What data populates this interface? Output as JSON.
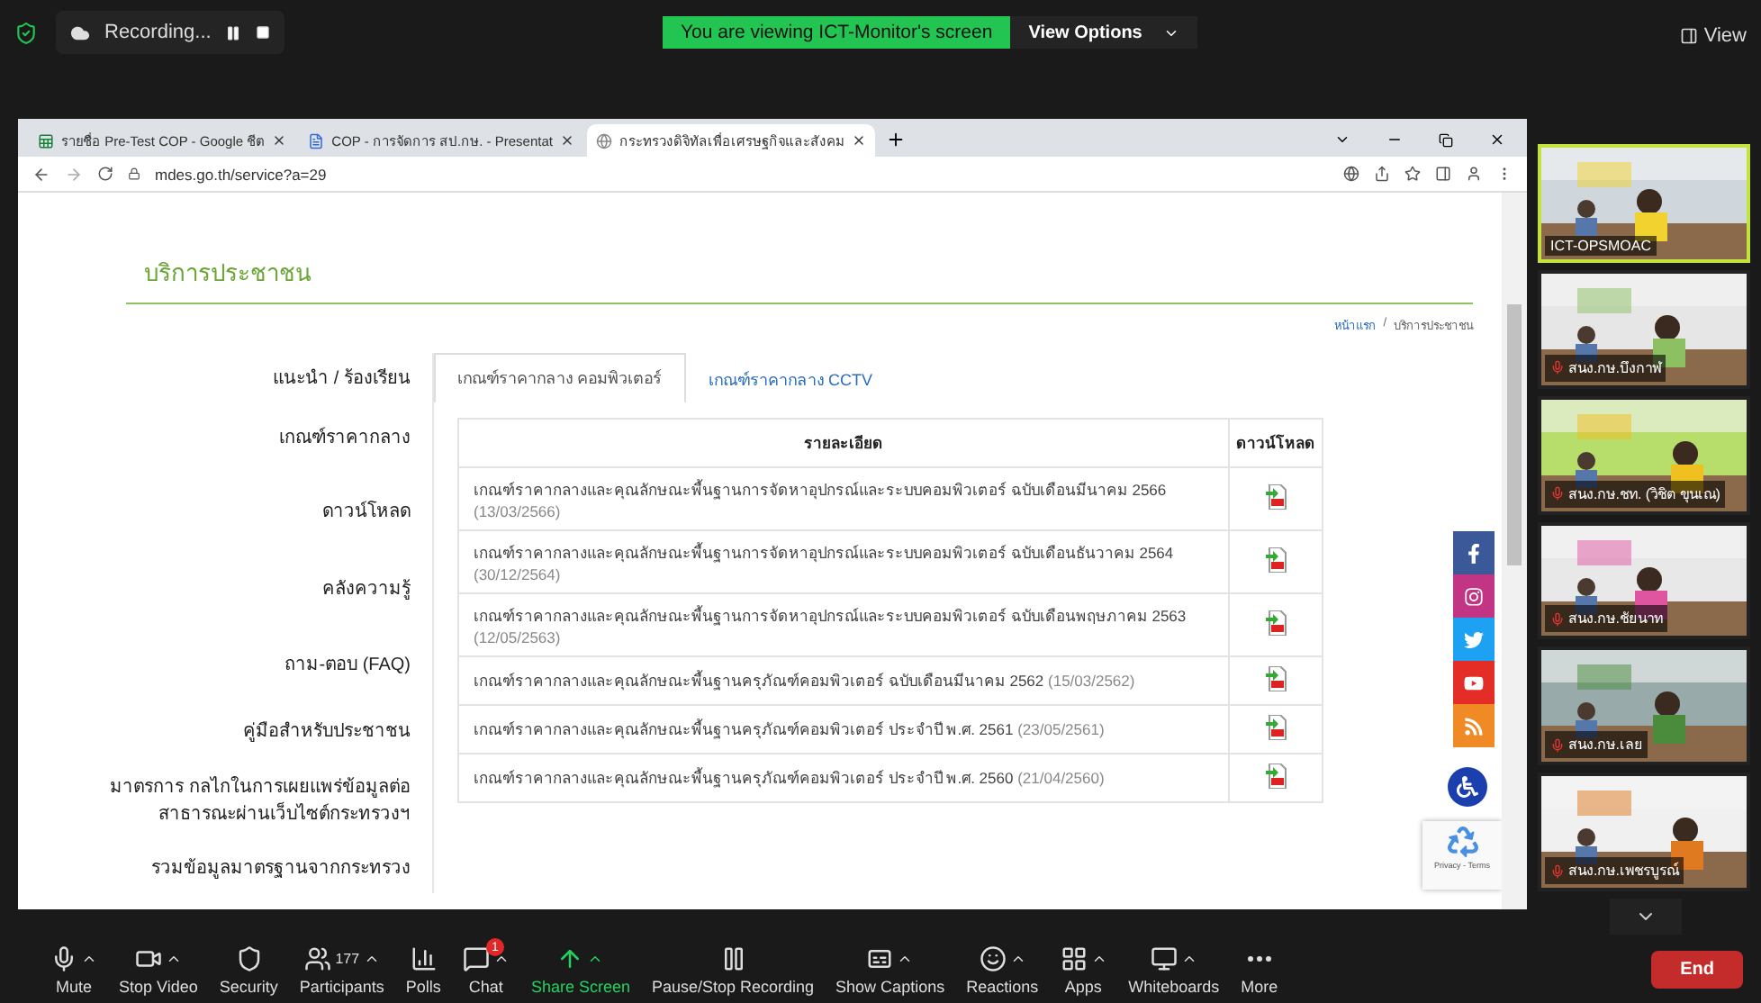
{
  "meeting_bar": {
    "recording": "Recording...",
    "banner": "You are viewing ICT-Monitor's screen",
    "view_options": "View Options",
    "view": "View"
  },
  "browser": {
    "tabs": [
      {
        "title": "รายชื่อ Pre-Test COP - Google ชีต",
        "selected": false
      },
      {
        "title": "COP - การจัดการ สป.กษ. - Presentat",
        "selected": false
      },
      {
        "title": "กระทรวงดิจิทัลเพื่อเศรษฐกิจและสังคม",
        "selected": true
      }
    ],
    "url": "mdes.go.th/service?a=29"
  },
  "page": {
    "heading": "บริการประชาชน",
    "breadcrumb_separator": "/",
    "breadcrumb": [
      {
        "label": "หน้าแรก",
        "link": true
      },
      {
        "label": "บริการประชาชน",
        "link": false
      }
    ],
    "sidebar": [
      "แนะนำ / ร้องเรียน",
      "เกณฑ์ราคากลาง",
      "ดาวน์โหลด",
      "คลังความรู้",
      "ถาม-ตอบ (FAQ)",
      "คู่มือสำหรับประชาชน",
      "มาตรการ กลไกในการเผยแพร่ข้อมูลต่อสาธารณะผ่านเว็บไซต์กระทรวงฯ",
      "รวมข้อมูลมาตรฐานจากกระทรวง"
    ],
    "tabs": [
      {
        "label": "เกณฑ์ราคากลาง คอมพิวเตอร์",
        "selected": true
      },
      {
        "label": "เกณฑ์ราคากลาง CCTV",
        "selected": false
      }
    ],
    "table": {
      "columns": [
        "รายละเอียด",
        "ดาวน์โหลด"
      ],
      "rows": [
        {
          "title": "เกณฑ์ราคากลางและคุณลักษณะพื้นฐานการจัดหาอุปกรณ์และระบบคอมพิวเตอร์ ฉบับเดือนมีนาคม 2566",
          "date": "(13/03/2566)"
        },
        {
          "title": "เกณฑ์ราคากลางและคุณลักษณะพื้นฐานการจัดหาอุปกรณ์และระบบคอมพิวเตอร์ ฉบับเดือนธันวาคม 2564",
          "date": "(30/12/2564)"
        },
        {
          "title": "เกณฑ์ราคากลางและคุณลักษณะพื้นฐานการจัดหาอุปกรณ์และระบบคอมพิวเตอร์ ฉบับเดือนพฤษภาคม 2563",
          "date": "(12/05/2563)"
        },
        {
          "title": "เกณฑ์ราคากลางและคุณลักษณะพื้นฐานครุภัณฑ์คอมพิวเตอร์ ฉบับเดือนมีนาคม 2562",
          "date": "(15/03/2562)"
        },
        {
          "title": "เกณฑ์ราคากลางและคุณลักษณะพื้นฐานครุภัณฑ์คอมพิวเตอร์ ประจำปี พ.ศ. 2561",
          "date": "(23/05/2561)"
        },
        {
          "title": "เกณฑ์ราคากลางและคุณลักษณะพื้นฐานครุภัณฑ์คอมพิวเตอร์ ประจำปี พ.ศ. 2560",
          "date": "(21/04/2560)"
        }
      ]
    },
    "recaptcha": "Privacy - Terms"
  },
  "participants": [
    {
      "name": "ICT-OPSMOAC",
      "speaking": true,
      "muted": false
    },
    {
      "name": "สนง.กษ.บึงกาฬ",
      "speaking": false,
      "muted": true
    },
    {
      "name": "สนง.กษ.ชท. (วิชิต ขุนเณ)",
      "speaking": false,
      "muted": true
    },
    {
      "name": "สนง.กษ.ชัยนาท",
      "speaking": false,
      "muted": true
    },
    {
      "name": "สนง.กษ.เลย",
      "speaking": false,
      "muted": true
    },
    {
      "name": "สนง.กษ.เพชรบูรณ์",
      "speaking": false,
      "muted": true
    }
  ],
  "toolbar": [
    {
      "label": "Mute",
      "menu": true,
      "highlight": false
    },
    {
      "label": "Stop Video",
      "menu": true,
      "highlight": false
    },
    {
      "label": "Security",
      "menu": false,
      "highlight": false
    },
    {
      "label": "Participants",
      "menu": true,
      "count": "177",
      "highlight": false
    },
    {
      "label": "Polls",
      "menu": false,
      "highlight": false
    },
    {
      "label": "Chat",
      "menu": true,
      "badge": "1",
      "highlight": false
    },
    {
      "label": "Share Screen",
      "menu": true,
      "highlight": true
    },
    {
      "label": "Pause/Stop Recording",
      "menu": false,
      "highlight": false
    },
    {
      "label": "Show Captions",
      "menu": true,
      "highlight": false
    },
    {
      "label": "Reactions",
      "menu": true,
      "highlight": false
    },
    {
      "label": "Apps",
      "menu": true,
      "highlight": false
    },
    {
      "label": "Whiteboards",
      "menu": true,
      "highlight": false
    },
    {
      "label": "More",
      "menu": false,
      "highlight": false
    }
  ],
  "end_button": "End"
}
